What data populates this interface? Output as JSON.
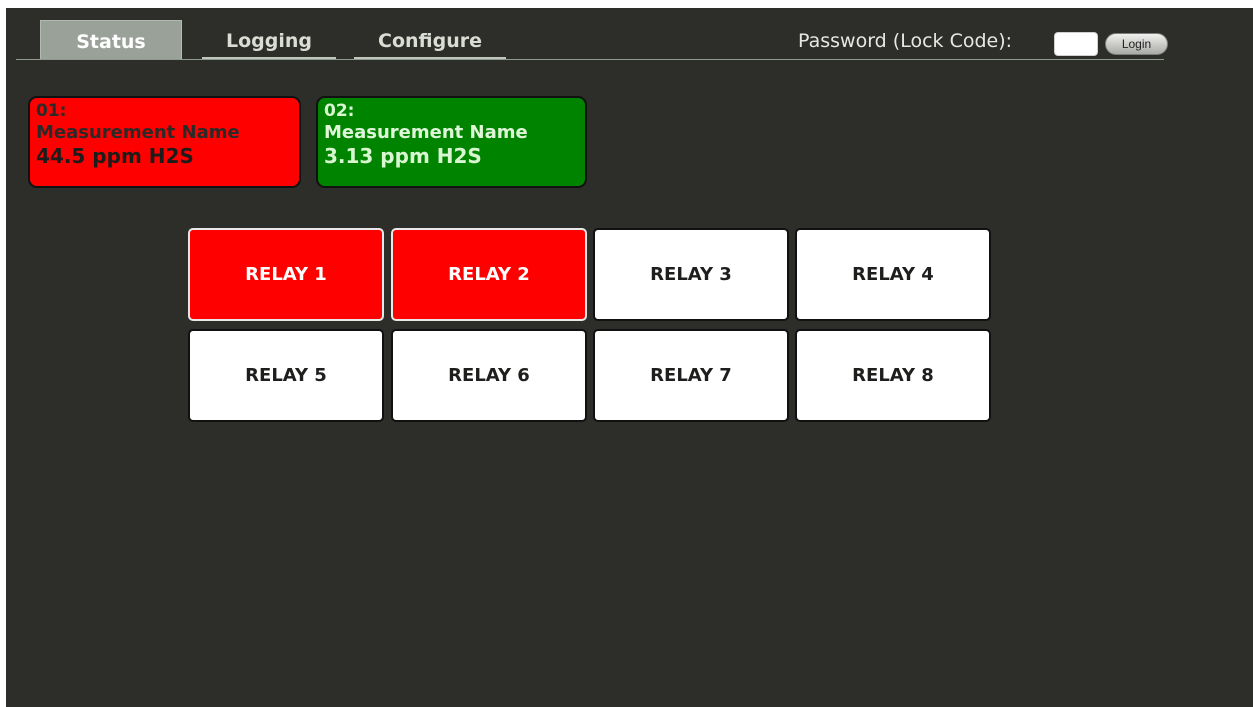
{
  "tabs": [
    {
      "label": "Status",
      "active": true
    },
    {
      "label": "Logging",
      "active": false
    },
    {
      "label": "Configure",
      "active": false
    }
  ],
  "login": {
    "password_label": "Password (Lock Code):",
    "password_value": "",
    "button_label": "Login"
  },
  "measurements": [
    {
      "id": "01:",
      "name": "Measurement Name",
      "value": "44.5 ppm H2S",
      "status_color": "#ff0000"
    },
    {
      "id": "02:",
      "name": "Measurement Name",
      "value": "3.13 ppm H2S",
      "status_color": "#008400"
    }
  ],
  "relays": [
    {
      "label": "RELAY 1",
      "state": "on"
    },
    {
      "label": "RELAY 2",
      "state": "on"
    },
    {
      "label": "RELAY 3",
      "state": "off"
    },
    {
      "label": "RELAY 4",
      "state": "off"
    },
    {
      "label": "RELAY 5",
      "state": "off"
    },
    {
      "label": "RELAY 6",
      "state": "off"
    },
    {
      "label": "RELAY 7",
      "state": "off"
    },
    {
      "label": "RELAY 8",
      "state": "off"
    }
  ],
  "colors": {
    "background": "#2d2d2a",
    "relay_on": "#ff0000",
    "relay_off": "#ffffff",
    "active_tab": "#9aa198"
  }
}
